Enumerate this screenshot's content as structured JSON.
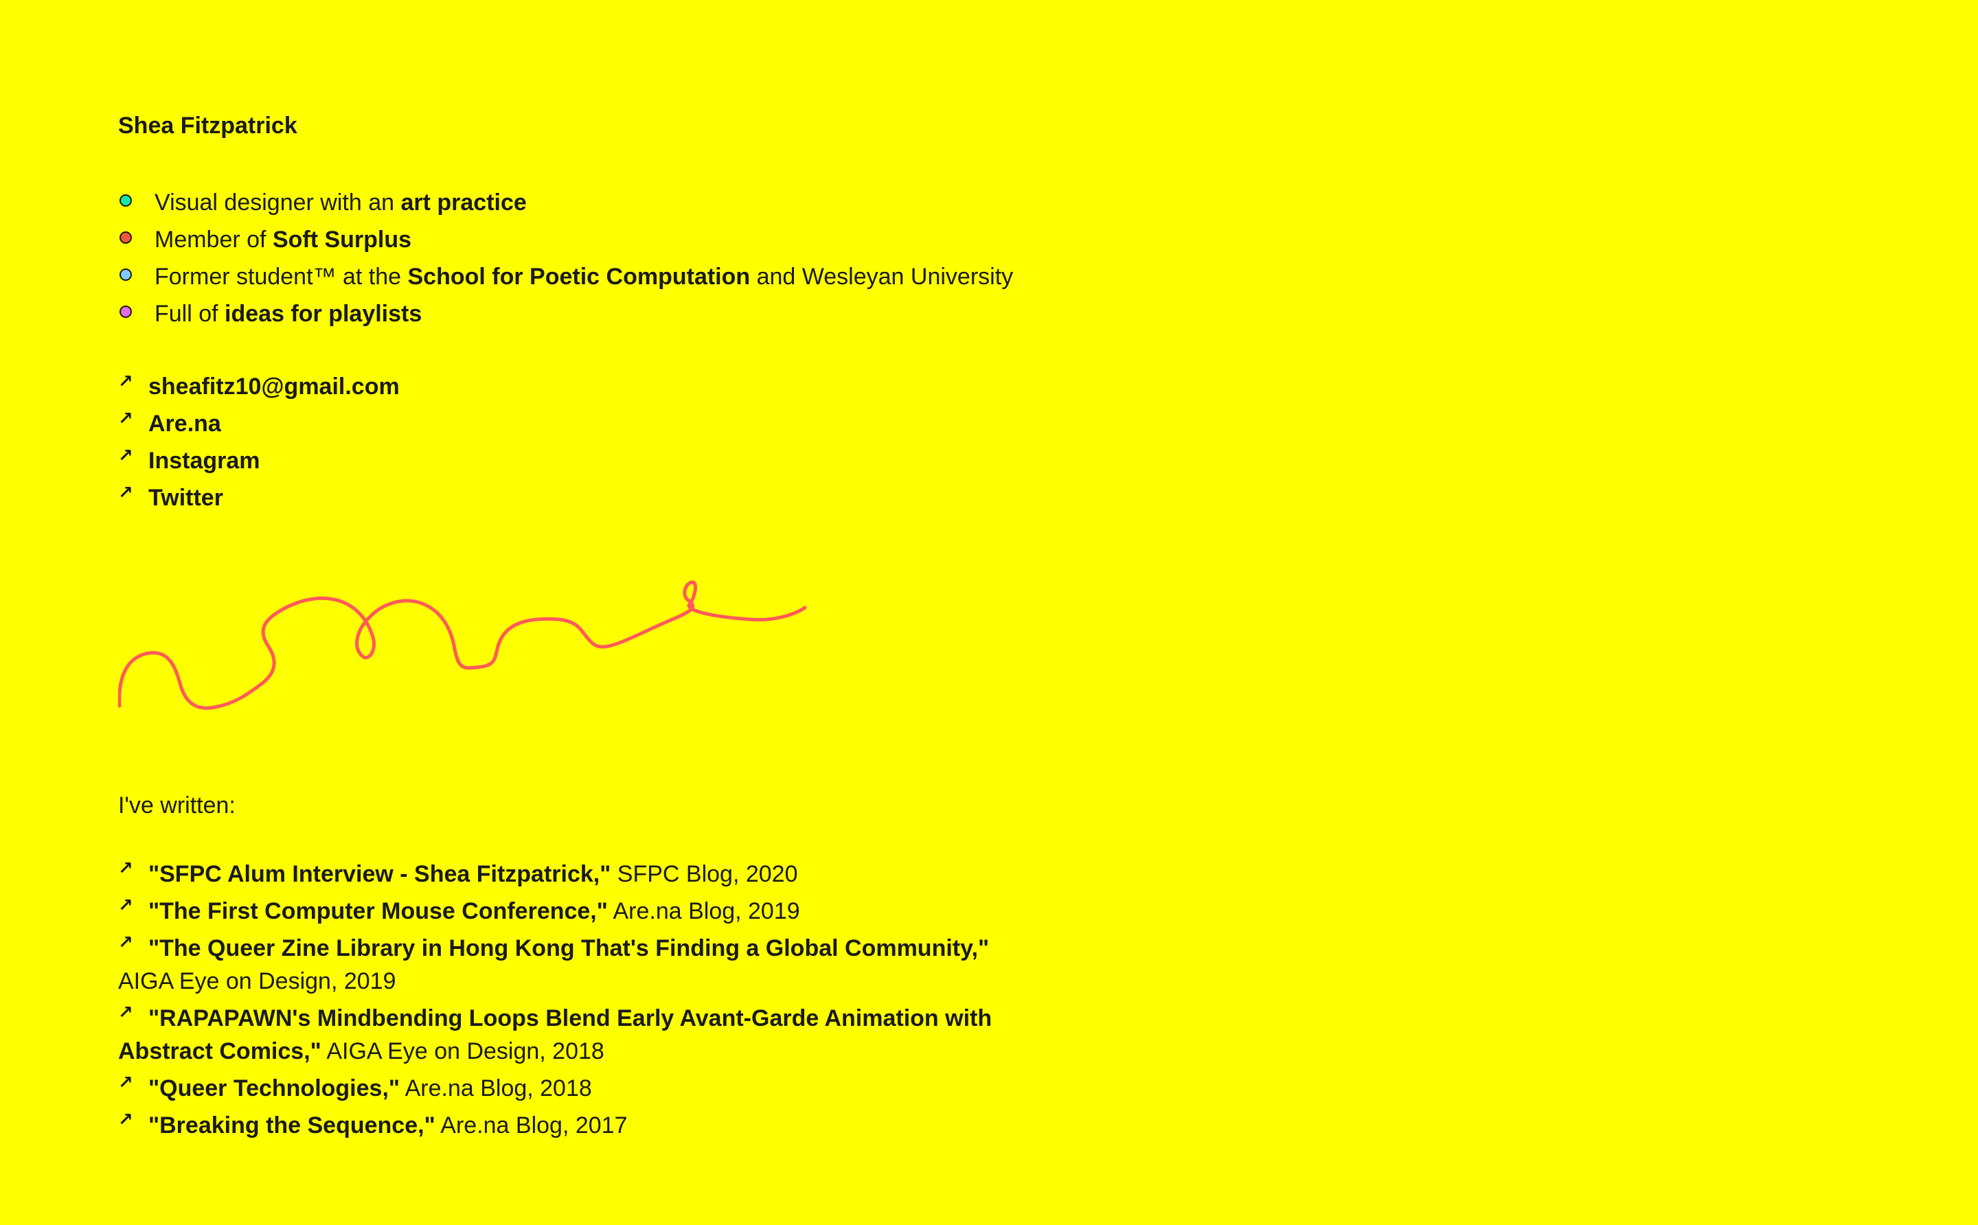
{
  "name": "Shea Fitzpatrick",
  "colors": {
    "background": "#ffff00",
    "text": "#1a1a1a",
    "squiggle": "#ff5a5a"
  },
  "about": [
    {
      "dot_color": "#19e6a6",
      "prefix": "Visual designer with an ",
      "link": "art practice",
      "suffix": ""
    },
    {
      "dot_color": "#f0563f",
      "prefix": "Member of ",
      "link": "Soft Surplus",
      "suffix": ""
    },
    {
      "dot_color": "#7ecbff",
      "prefix": "Former student™ at the ",
      "link": "School for Poetic Computation",
      "suffix": " and Wesleyan University"
    },
    {
      "dot_color": "#e46be6",
      "prefix": "Full of ",
      "link": "ideas for playlists",
      "suffix": ""
    }
  ],
  "links": [
    {
      "icon": "arrow-up-right-icon",
      "label": "sheafitz10@gmail.com"
    },
    {
      "icon": "arrow-up-right-icon",
      "label": "Are.na"
    },
    {
      "icon": "arrow-up-right-icon",
      "label": "Instagram"
    },
    {
      "icon": "arrow-up-right-icon",
      "label": "Twitter"
    }
  ],
  "writing_heading": "I've written:",
  "writing": [
    {
      "title": "\"SFPC Alum Interview - Shea Fitzpatrick,\"",
      "source": " SFPC Blog, 2020"
    },
    {
      "title": "\"The First Computer Mouse Conference,\"",
      "source": " Are.na Blog, 2019"
    },
    {
      "title": "\"The Queer Zine Library in Hong Kong That's Finding a Global Community,\"",
      "source": " AIGA Eye on Design, 2019"
    },
    {
      "title": "\"RAPAPAWN's Mindbending Loops Blend Early Avant-Garde Animation with Abstract Comics,\"",
      "source": " AIGA Eye on Design, 2018"
    },
    {
      "title": "\"Queer Technologies,\"",
      "source": " Are.na Blog, 2018"
    },
    {
      "title": "\"Breaking the Sequence,\"",
      "source": " Are.na Blog, 2017"
    }
  ],
  "arrow_glyph": "↗"
}
